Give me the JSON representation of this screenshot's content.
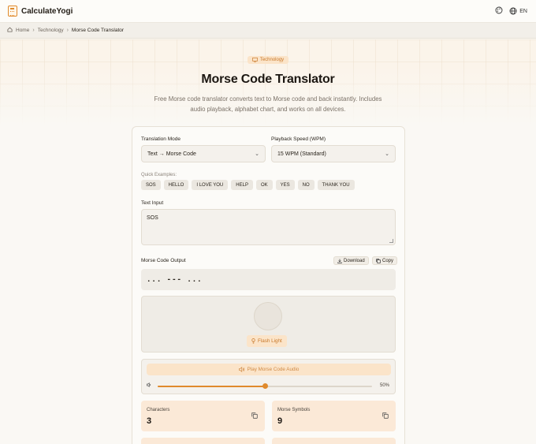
{
  "header": {
    "brand": "CalculateYogi",
    "lang": "EN"
  },
  "breadcrumb": {
    "home": "Home",
    "section": "Technology",
    "current": "Morse Code Translator"
  },
  "hero": {
    "tag": "Technology",
    "title": "Morse Code Translator",
    "description": "Free Morse code translator converts text to Morse code and back instantly. Includes audio playback, alphabet chart, and works on all devices."
  },
  "form": {
    "mode_label": "Translation Mode",
    "mode_value": "Text → Morse Code",
    "speed_label": "Playback Speed (WPM)",
    "speed_value": "15 WPM (Standard)",
    "quick_label": "Quick Examples:",
    "quick_examples": [
      "SOS",
      "HELLO",
      "I LOVE YOU",
      "HELP",
      "OK",
      "YES",
      "NO",
      "THANK YOU"
    ],
    "input_label": "Text Input",
    "input_value": "SOS",
    "output_label": "Morse Code Output",
    "download_label": "Download",
    "copy_label": "Copy",
    "output_value": "... --- ...",
    "flash_label": "Flash Light",
    "play_label": "Play Morse Code Audio",
    "volume_percent": 50,
    "volume_label": "50%"
  },
  "stats": [
    {
      "label": "Characters",
      "value": "3"
    },
    {
      "label": "Morse Symbols",
      "value": "9"
    }
  ],
  "colors": {
    "accent": "#e08a2c",
    "accent_bg": "#fbe4c9",
    "stat_bg": "#fbe9d7"
  }
}
